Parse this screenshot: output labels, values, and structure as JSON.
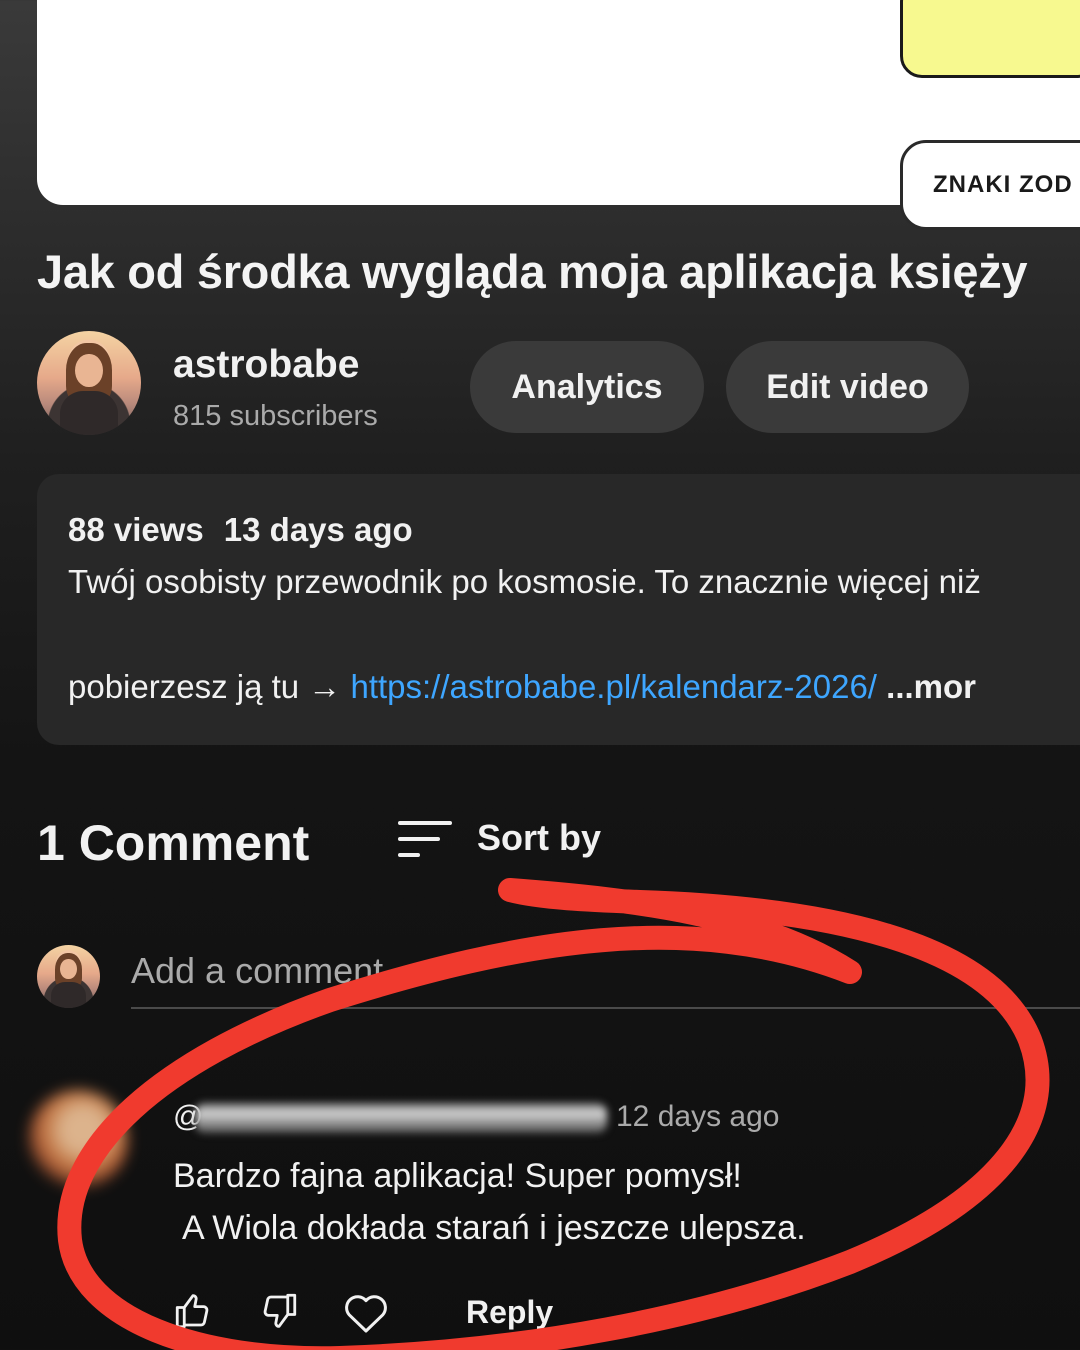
{
  "player": {
    "zodiac_label": "ZNAKI ZOD"
  },
  "video": {
    "title": "Jak od środka wygląda moja aplikacja księży"
  },
  "channel": {
    "name": "astrobabe",
    "subscribers": "815 subscribers"
  },
  "actions": {
    "analytics": "Analytics",
    "edit_video": "Edit video"
  },
  "description": {
    "views": "88 views",
    "age": "13 days ago",
    "line1": "Twój osobisty przewodnik po kosmosie. To znacznie więcej niż",
    "line2_prefix": "pobierzesz ją tu → ",
    "link": "https://astrobabe.pl/kalendarz-2026/",
    "more": " ...mor"
  },
  "comments": {
    "count_label": "1 Comment",
    "sort_label": "Sort by",
    "add_placeholder": "Add a comment",
    "items": [
      {
        "author_prefix": "@",
        "time": "12 days ago",
        "line1": "Bardzo fajna aplikacja! Super pomysł!",
        "line2": "A Wiola dokłada starań i jeszcze ulepsza.",
        "reply_label": "Reply"
      }
    ]
  },
  "icons": [
    "sort-icon",
    "like-icon",
    "dislike-icon",
    "heart-icon"
  ],
  "colors": {
    "link": "#3ea6ff",
    "annotation": "#f03a2e",
    "player_card": "#f7f98f"
  }
}
